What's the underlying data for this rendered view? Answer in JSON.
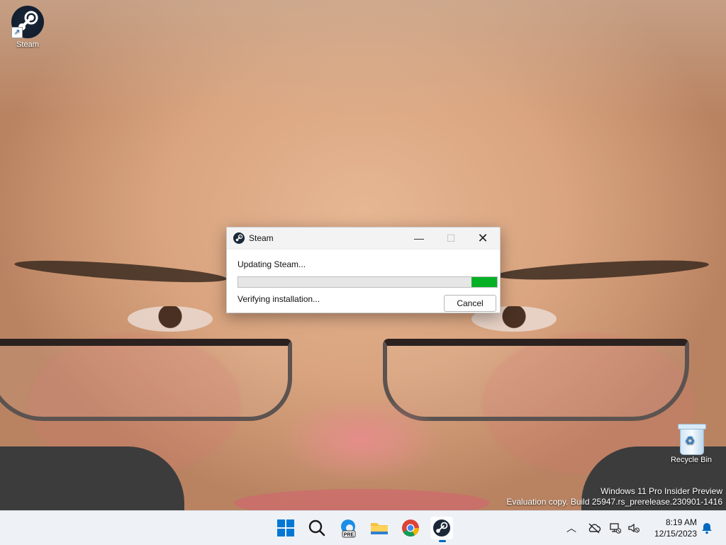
{
  "desktop": {
    "icons": [
      {
        "label": "Steam"
      },
      {
        "label": "Recycle Bin"
      }
    ],
    "watermark": {
      "line1": "Windows 11 Pro Insider Preview",
      "line2": "Evaluation copy. Build 25947.rs_prerelease.230901-1416"
    }
  },
  "dialog": {
    "title": "Steam",
    "status_text": "Updating Steam...",
    "progress_fraction": 0.1,
    "detail_text": "Verifying installation...",
    "cancel_label": "Cancel",
    "minimize_glyph": "—",
    "maximize_glyph": "☐",
    "close_glyph": "✕"
  },
  "taskbar": {
    "apps": [
      {
        "name": "start",
        "icon": "windows-logo-icon"
      },
      {
        "name": "search",
        "icon": "search-icon"
      },
      {
        "name": "edge-pre",
        "icon": "edge-icon",
        "badge": "PRE"
      },
      {
        "name": "file-explorer",
        "icon": "folder-icon"
      },
      {
        "name": "chrome",
        "icon": "chrome-icon"
      },
      {
        "name": "steam",
        "icon": "steam-icon",
        "active": true
      }
    ],
    "tray": {
      "time": "8:19 AM",
      "date": "12/15/2023"
    }
  },
  "colors": {
    "progress_fill": "#06b025",
    "taskbar_bg": "#eef2f7",
    "accent": "#0078d4"
  }
}
